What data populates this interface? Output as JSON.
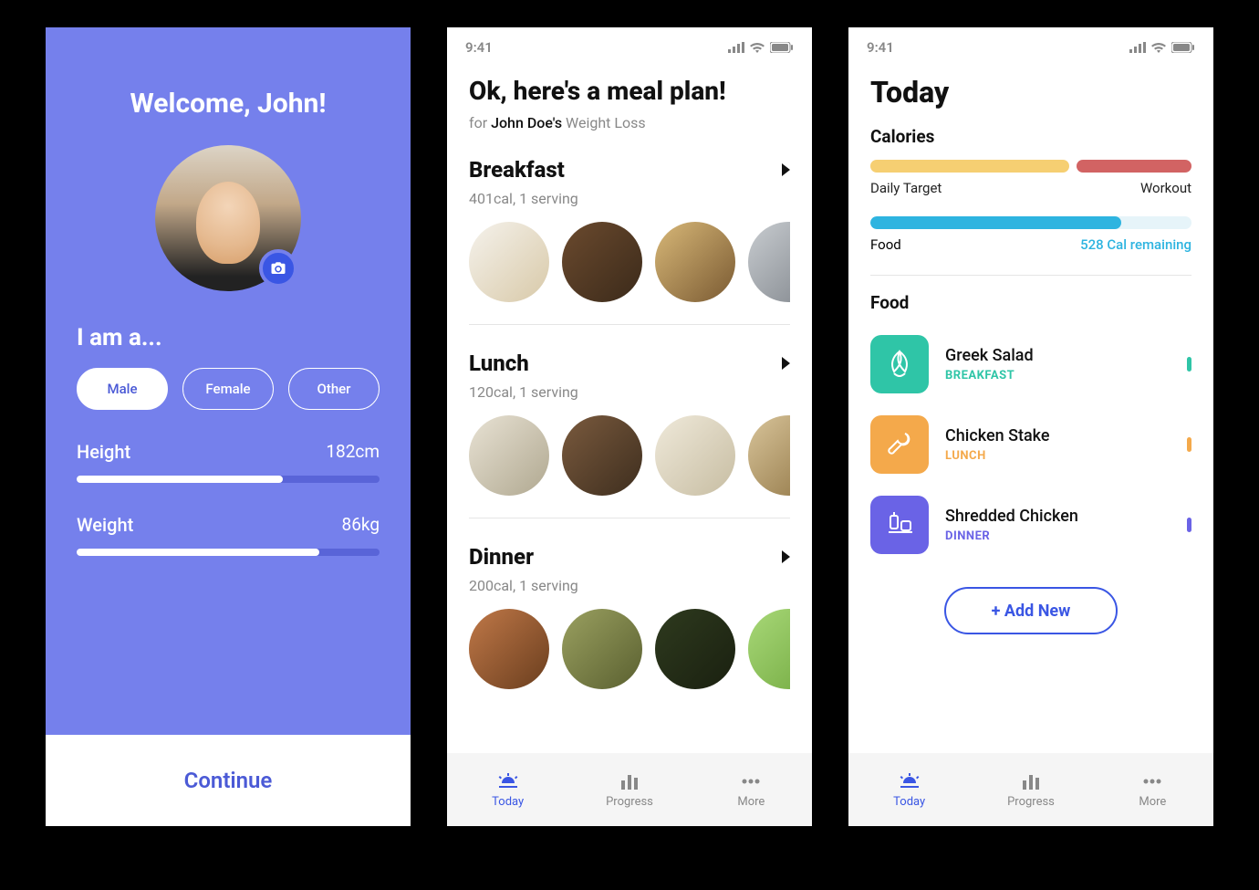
{
  "statusbar": {
    "time": "9:41"
  },
  "screen1": {
    "title": "Welcome, John!",
    "subtitle": "I am a...",
    "genders": [
      "Male",
      "Female",
      "Other"
    ],
    "height_label": "Height",
    "height_value": "182cm",
    "height_pct": 68,
    "weight_label": "Weight",
    "weight_value": "86kg",
    "weight_pct": 80,
    "continue": "Continue"
  },
  "screen2": {
    "title": "Ok, here's a meal plan!",
    "sub_prefix": "for ",
    "sub_name": "John Doe's",
    "sub_goal": " Weight Loss",
    "meals": [
      {
        "title": "Breakfast",
        "sub": "401cal, 1 serving"
      },
      {
        "title": "Lunch",
        "sub": "120cal, 1 serving"
      },
      {
        "title": "Dinner",
        "sub": "200cal, 1 serving"
      }
    ]
  },
  "screen3": {
    "title": "Today",
    "calories_label": "Calories",
    "target_label": "Daily Target",
    "workout_label": "Workout",
    "food_label": "Food",
    "remaining_label": "528 Cal remaining",
    "food_section": "Food",
    "items": [
      {
        "name": "Greek Salad",
        "meal": "BREAKFAST",
        "color": "teal"
      },
      {
        "name": "Chicken Stake",
        "meal": "LUNCH",
        "color": "orange"
      },
      {
        "name": "Shredded Chicken",
        "meal": "DINNER",
        "color": "purple"
      }
    ],
    "add_new": "+  Add New"
  },
  "tabs": {
    "today": "Today",
    "progress": "Progress",
    "more": "More"
  }
}
